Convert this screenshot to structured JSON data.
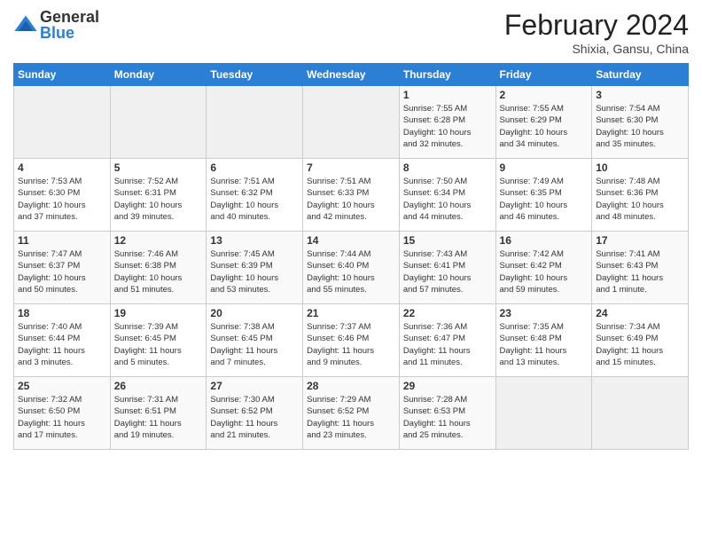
{
  "logo": {
    "general": "General",
    "blue": "Blue"
  },
  "title": "February 2024",
  "subtitle": "Shixia, Gansu, China",
  "headers": [
    "Sunday",
    "Monday",
    "Tuesday",
    "Wednesday",
    "Thursday",
    "Friday",
    "Saturday"
  ],
  "weeks": [
    [
      {
        "num": "",
        "info": ""
      },
      {
        "num": "",
        "info": ""
      },
      {
        "num": "",
        "info": ""
      },
      {
        "num": "",
        "info": ""
      },
      {
        "num": "1",
        "info": "Sunrise: 7:55 AM\nSunset: 6:28 PM\nDaylight: 10 hours\nand 32 minutes."
      },
      {
        "num": "2",
        "info": "Sunrise: 7:55 AM\nSunset: 6:29 PM\nDaylight: 10 hours\nand 34 minutes."
      },
      {
        "num": "3",
        "info": "Sunrise: 7:54 AM\nSunset: 6:30 PM\nDaylight: 10 hours\nand 35 minutes."
      }
    ],
    [
      {
        "num": "4",
        "info": "Sunrise: 7:53 AM\nSunset: 6:30 PM\nDaylight: 10 hours\nand 37 minutes."
      },
      {
        "num": "5",
        "info": "Sunrise: 7:52 AM\nSunset: 6:31 PM\nDaylight: 10 hours\nand 39 minutes."
      },
      {
        "num": "6",
        "info": "Sunrise: 7:51 AM\nSunset: 6:32 PM\nDaylight: 10 hours\nand 40 minutes."
      },
      {
        "num": "7",
        "info": "Sunrise: 7:51 AM\nSunset: 6:33 PM\nDaylight: 10 hours\nand 42 minutes."
      },
      {
        "num": "8",
        "info": "Sunrise: 7:50 AM\nSunset: 6:34 PM\nDaylight: 10 hours\nand 44 minutes."
      },
      {
        "num": "9",
        "info": "Sunrise: 7:49 AM\nSunset: 6:35 PM\nDaylight: 10 hours\nand 46 minutes."
      },
      {
        "num": "10",
        "info": "Sunrise: 7:48 AM\nSunset: 6:36 PM\nDaylight: 10 hours\nand 48 minutes."
      }
    ],
    [
      {
        "num": "11",
        "info": "Sunrise: 7:47 AM\nSunset: 6:37 PM\nDaylight: 10 hours\nand 50 minutes."
      },
      {
        "num": "12",
        "info": "Sunrise: 7:46 AM\nSunset: 6:38 PM\nDaylight: 10 hours\nand 51 minutes."
      },
      {
        "num": "13",
        "info": "Sunrise: 7:45 AM\nSunset: 6:39 PM\nDaylight: 10 hours\nand 53 minutes."
      },
      {
        "num": "14",
        "info": "Sunrise: 7:44 AM\nSunset: 6:40 PM\nDaylight: 10 hours\nand 55 minutes."
      },
      {
        "num": "15",
        "info": "Sunrise: 7:43 AM\nSunset: 6:41 PM\nDaylight: 10 hours\nand 57 minutes."
      },
      {
        "num": "16",
        "info": "Sunrise: 7:42 AM\nSunset: 6:42 PM\nDaylight: 10 hours\nand 59 minutes."
      },
      {
        "num": "17",
        "info": "Sunrise: 7:41 AM\nSunset: 6:43 PM\nDaylight: 11 hours\nand 1 minute."
      }
    ],
    [
      {
        "num": "18",
        "info": "Sunrise: 7:40 AM\nSunset: 6:44 PM\nDaylight: 11 hours\nand 3 minutes."
      },
      {
        "num": "19",
        "info": "Sunrise: 7:39 AM\nSunset: 6:45 PM\nDaylight: 11 hours\nand 5 minutes."
      },
      {
        "num": "20",
        "info": "Sunrise: 7:38 AM\nSunset: 6:45 PM\nDaylight: 11 hours\nand 7 minutes."
      },
      {
        "num": "21",
        "info": "Sunrise: 7:37 AM\nSunset: 6:46 PM\nDaylight: 11 hours\nand 9 minutes."
      },
      {
        "num": "22",
        "info": "Sunrise: 7:36 AM\nSunset: 6:47 PM\nDaylight: 11 hours\nand 11 minutes."
      },
      {
        "num": "23",
        "info": "Sunrise: 7:35 AM\nSunset: 6:48 PM\nDaylight: 11 hours\nand 13 minutes."
      },
      {
        "num": "24",
        "info": "Sunrise: 7:34 AM\nSunset: 6:49 PM\nDaylight: 11 hours\nand 15 minutes."
      }
    ],
    [
      {
        "num": "25",
        "info": "Sunrise: 7:32 AM\nSunset: 6:50 PM\nDaylight: 11 hours\nand 17 minutes."
      },
      {
        "num": "26",
        "info": "Sunrise: 7:31 AM\nSunset: 6:51 PM\nDaylight: 11 hours\nand 19 minutes."
      },
      {
        "num": "27",
        "info": "Sunrise: 7:30 AM\nSunset: 6:52 PM\nDaylight: 11 hours\nand 21 minutes."
      },
      {
        "num": "28",
        "info": "Sunrise: 7:29 AM\nSunset: 6:52 PM\nDaylight: 11 hours\nand 23 minutes."
      },
      {
        "num": "29",
        "info": "Sunrise: 7:28 AM\nSunset: 6:53 PM\nDaylight: 11 hours\nand 25 minutes."
      },
      {
        "num": "",
        "info": ""
      },
      {
        "num": "",
        "info": ""
      }
    ]
  ]
}
